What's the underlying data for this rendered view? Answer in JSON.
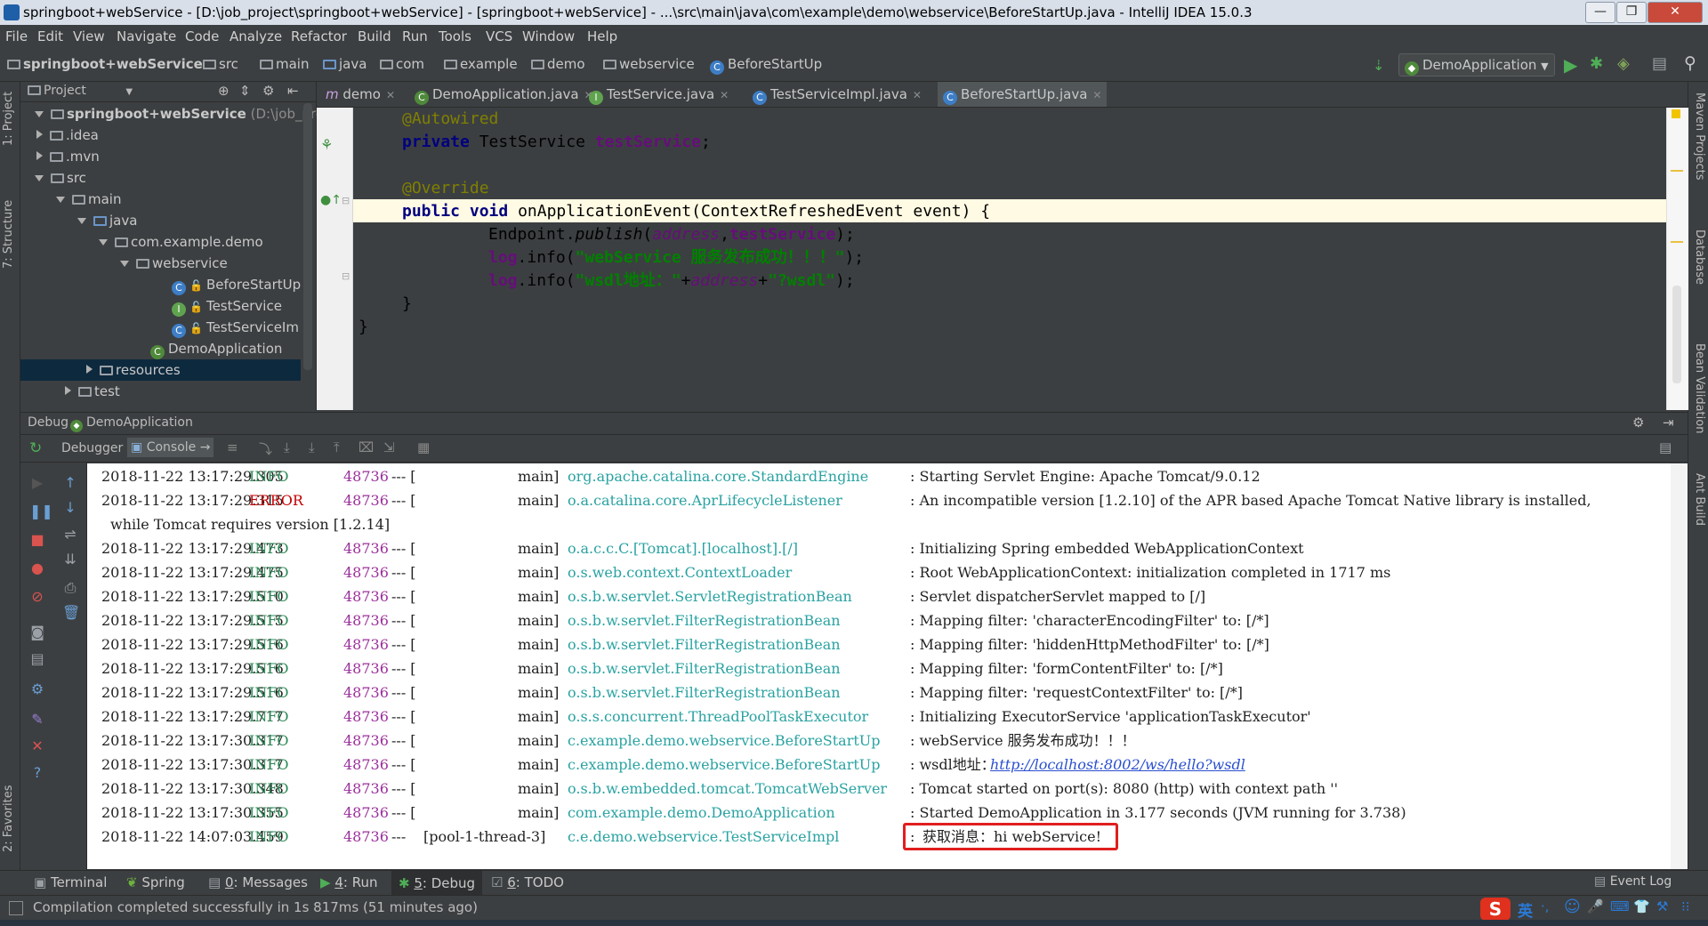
{
  "window": {
    "title": "springboot+webService - [D:\\job_project\\springboot+webService] - [springboot+webService] - ...\\src\\main\\java\\com\\example\\demo\\webservice\\BeforeStartUp.java - IntelliJ IDEA 15.0.3",
    "minimize": "—",
    "maximize": "❐",
    "close": "✕"
  },
  "menu": [
    "File",
    "Edit",
    "View",
    "Navigate",
    "Code",
    "Analyze",
    "Refactor",
    "Build",
    "Run",
    "Tools",
    "VCS",
    "Window",
    "Help"
  ],
  "breadcrumbs": [
    "springboot+webService",
    "src",
    "main",
    "java",
    "com",
    "example",
    "demo",
    "webservice",
    "BeforeStartUp"
  ],
  "run_config": "DemoApplication",
  "left_strip": {
    "project": "1: Project",
    "structure": "7: Structure",
    "favorites": "2: Favorites"
  },
  "right_strip": {
    "maven": "Maven Projects",
    "database": "Database",
    "bean": "Bean Validation",
    "ant": "Ant Build"
  },
  "project_panel": {
    "title": "Project",
    "root_name": "springboot+webService",
    "root_path": "(D:\\job_pro",
    "items": [
      ".idea",
      ".mvn",
      "src",
      "main",
      "java",
      "com.example.demo",
      "webservice",
      "BeforeStartUp",
      "TestService",
      "TestServiceIm",
      "DemoApplication",
      "resources",
      "test"
    ]
  },
  "editor_tabs": [
    "demo",
    "DemoApplication.java",
    "TestService.java",
    "TestServiceImpl.java",
    "BeforeStartUp.java"
  ],
  "code": {
    "l1_ann": "@Autowired",
    "l2_kw": "private",
    "l2_type": " TestService ",
    "l2_field": "testService",
    "l2_end": ";",
    "l4_ann": "@Override",
    "l5_kw1": "public",
    "l5_kw2": "void",
    "l5_rest": " onApplicationEvent(ContextRefreshedEvent event) {",
    "l6_a": "Endpoint.",
    "l6_b": "publish",
    "l6_c": "(",
    "l6_d": "address",
    "l6_e": ",",
    "l6_f": "testService",
    "l6_g": ");",
    "l7_a": "log",
    "l7_b": ".info(",
    "l7_c": "\"webService 服务发布成功！！！\"",
    "l7_d": ");",
    "l8_a": "log",
    "l8_b": ".info(",
    "l8_c": "\"wsdl地址：\"",
    "l8_d": "+",
    "l8_e": "address",
    "l8_f": "+",
    "l8_g": "\"?wsdl\"",
    "l8_h": ");",
    "l9": "}",
    "l10": "}"
  },
  "debug": {
    "title": "Debug",
    "config": "DemoApplication",
    "tab_debugger": "Debugger",
    "tab_console": "Console"
  },
  "console": {
    "lines": [
      {
        "ts": "2018-11-22 13:17:29.305",
        "level": "INFO",
        "pid": "48736",
        "sep": "--- [",
        "thread": "main]",
        "logger": "org.apache.catalina.core.StandardEngine",
        "msg": ": Starting Servlet Engine: Apache Tomcat/9.0.12"
      },
      {
        "ts": "2018-11-22 13:17:29.315",
        "level": "ERROR",
        "pid": "48736",
        "sep": "--- [",
        "thread": "main]",
        "logger": "o.a.catalina.core.AprLifecycleListener",
        "msg": ": An incompatible version [1.2.10] of the APR based Apache Tomcat Native library is installed,"
      },
      {
        "ts": "2018-11-22 13:17:29.473",
        "level": "INFO",
        "pid": "48736",
        "sep": "--- [",
        "thread": "main]",
        "logger": "o.a.c.c.C.[Tomcat].[localhost].[/]",
        "msg": ": Initializing Spring embedded WebApplicationContext"
      },
      {
        "ts": "2018-11-22 13:17:29.475",
        "level": "INFO",
        "pid": "48736",
        "sep": "--- [",
        "thread": "main]",
        "logger": "o.s.web.context.ContextLoader",
        "msg": ": Root WebApplicationContext: initialization completed in 1717 ms"
      },
      {
        "ts": "2018-11-22 13:17:29.510",
        "level": "INFO",
        "pid": "48736",
        "sep": "--- [",
        "thread": "main]",
        "logger": "o.s.b.w.servlet.ServletRegistrationBean",
        "msg": ": Servlet dispatcherServlet mapped to [/]"
      },
      {
        "ts": "2018-11-22 13:17:29.515",
        "level": "INFO",
        "pid": "48736",
        "sep": "--- [",
        "thread": "main]",
        "logger": "o.s.b.w.servlet.FilterRegistrationBean",
        "msg": ": Mapping filter: 'characterEncodingFilter' to: [/*]"
      },
      {
        "ts": "2018-11-22 13:17:29.516",
        "level": "INFO",
        "pid": "48736",
        "sep": "--- [",
        "thread": "main]",
        "logger": "o.s.b.w.servlet.FilterRegistrationBean",
        "msg": ": Mapping filter: 'hiddenHttpMethodFilter' to: [/*]"
      },
      {
        "ts": "2018-11-22 13:17:29.516",
        "level": "INFO",
        "pid": "48736",
        "sep": "--- [",
        "thread": "main]",
        "logger": "o.s.b.w.servlet.FilterRegistrationBean",
        "msg": ": Mapping filter: 'formContentFilter' to: [/*]"
      },
      {
        "ts": "2018-11-22 13:17:29.516",
        "level": "INFO",
        "pid": "48736",
        "sep": "--- [",
        "thread": "main]",
        "logger": "o.s.b.w.servlet.FilterRegistrationBean",
        "msg": ": Mapping filter: 'requestContextFilter' to: [/*]"
      },
      {
        "ts": "2018-11-22 13:17:29.717",
        "level": "INFO",
        "pid": "48736",
        "sep": "--- [",
        "thread": "main]",
        "logger": "o.s.s.concurrent.ThreadPoolTaskExecutor",
        "msg": ": Initializing ExecutorService 'applicationTaskExecutor'"
      },
      {
        "ts": "2018-11-22 13:17:30.317",
        "level": "INFO",
        "pid": "48736",
        "sep": "--- [",
        "thread": "main]",
        "logger": "c.example.demo.webservice.BeforeStartUp",
        "msg": ": webService 服务发布成功！！！"
      },
      {
        "ts": "2018-11-22 13:17:30.317",
        "level": "INFO",
        "pid": "48736",
        "sep": "--- [",
        "thread": "main]",
        "logger": "c.example.demo.webservice.BeforeStartUp",
        "msg": ": wsdl地址："
      },
      {
        "ts": "2018-11-22 13:17:30.348",
        "level": "INFO",
        "pid": "48736",
        "sep": "--- [",
        "thread": "main]",
        "logger": "o.s.b.w.embedded.tomcat.TomcatWebServer",
        "msg": ": Tomcat started on port(s): 8080 (http) with context path ''"
      },
      {
        "ts": "2018-11-22 13:17:30.355",
        "level": "INFO",
        "pid": "48736",
        "sep": "--- [",
        "thread": "main]",
        "logger": "com.example.demo.DemoApplication",
        "msg": ": Started DemoApplication in 3.177 seconds (JVM running for 3.738)"
      },
      {
        "ts": "2018-11-22 14:07:03.459",
        "level": "INFO",
        "pid": "48736",
        "sep": "---",
        "thread": "[pool-1-thread-3]",
        "logger": "c.e.demo.webservice.TestServiceImpl",
        "msg": ":",
        "msg_boxed": "获取消息：hi webService!"
      }
    ],
    "wrap_line": "while Tomcat requires version [1.2.14]",
    "wsdl_url": "http://localhost:8002/ws/hello?wsdl"
  },
  "bottom_tabs": [
    {
      "key": "",
      "label": "Terminal"
    },
    {
      "key": "",
      "label": "Spring"
    },
    {
      "key": "0",
      "label": ": Messages"
    },
    {
      "key": "4",
      "label": ": Run"
    },
    {
      "key": "5",
      "label": ": Debug"
    },
    {
      "key": "6",
      "label": ": TODO"
    }
  ],
  "event_log": "Event Log",
  "status": "Compilation completed successfully in 1s 817ms (51 minutes ago)",
  "ime": [
    "英",
    "·,",
    "☺",
    "🎤",
    "⌨",
    "👕",
    "⚒",
    "⁝⁝"
  ],
  "colors": {
    "accent": "#e01e1e",
    "info": "#2e8b57",
    "error": "#c00000"
  }
}
